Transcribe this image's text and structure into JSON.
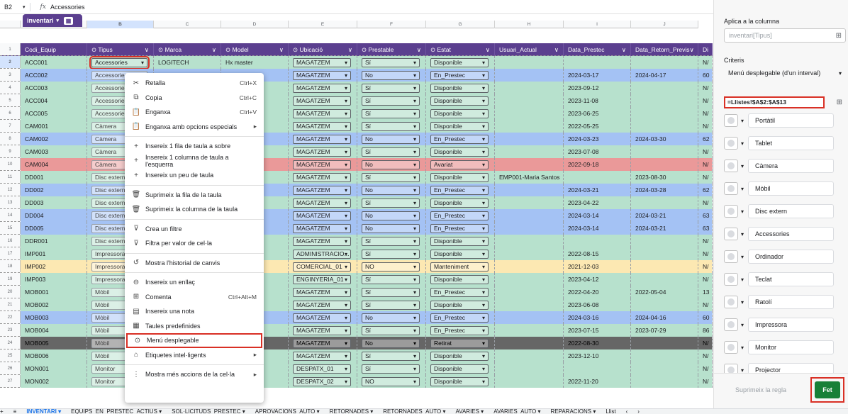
{
  "formula_bar": {
    "cell_ref": "B2",
    "fx": "fx",
    "value": "Accessories"
  },
  "columns": [
    "A",
    "B",
    "C",
    "D",
    "E",
    "F",
    "G",
    "H",
    "I",
    "J"
  ],
  "table_tab": {
    "label": "inventari"
  },
  "headers": [
    "Codi_Equip",
    "Tipus",
    "Marca",
    "Model",
    "Ubicació",
    "Prestable",
    "Estat",
    "Usuari_Actual",
    "Data_Prestec",
    "Data_Retorn_Previs",
    "Di"
  ],
  "rows": [
    {
      "n": "2",
      "bg": "#b7e1cd",
      "a": "ACC001",
      "b": "Accessories",
      "c": "LOGITECH",
      "d": "Hx master",
      "e": "MAGATZEM",
      "f": "Sí",
      "g": "Disponible",
      "h": "",
      "i": "",
      "j": "",
      "k": "N/"
    },
    {
      "n": "3",
      "bg": "#a4c2f4",
      "a": "ACC002",
      "b": "Accessories",
      "c": "",
      "d": "d",
      "e": "MAGATZEM",
      "f": "No",
      "g": "En_Prestec",
      "h": "",
      "i": "2024-03-17",
      "j": "2024-04-17",
      "k": "60"
    },
    {
      "n": "4",
      "bg": "#b7e1cd",
      "a": "ACC003",
      "b": "Accessories",
      "c": "",
      "d": "ve",
      "e": "MAGATZEM",
      "f": "Sí",
      "g": "Disponible",
      "h": "",
      "i": "2023-09-12",
      "j": "",
      "k": "N/"
    },
    {
      "n": "5",
      "bg": "#b7e1cd",
      "a": "ACC004",
      "b": "Accessories",
      "c": "",
      "d": "",
      "e": "MAGATZEM",
      "f": "Sí",
      "g": "Disponible",
      "h": "",
      "i": "2023-11-08",
      "j": "",
      "k": "N/"
    },
    {
      "n": "6",
      "bg": "#b7e1cd",
      "a": "ACC005",
      "b": "Accessories",
      "c": "",
      "d": "t",
      "e": "MAGATZEM",
      "f": "Sí",
      "g": "Disponible",
      "h": "",
      "i": "2023-06-25",
      "j": "",
      "k": "N/"
    },
    {
      "n": "7",
      "bg": "#b7e1cd",
      "a": "CAM001",
      "b": "Càmera",
      "c": "",
      "d": "",
      "e": "MAGATZEM",
      "f": "Sí",
      "g": "Disponible",
      "h": "",
      "i": "2022-05-25",
      "j": "",
      "k": "N/"
    },
    {
      "n": "8",
      "bg": "#a4c2f4",
      "a": "CAM002",
      "b": "Càmera",
      "c": "",
      "d": "",
      "e": "MAGATZEM",
      "f": "No",
      "g": "En_Prestec",
      "h": "",
      "i": "2024-03-23",
      "j": "2024-03-30",
      "k": "62"
    },
    {
      "n": "9",
      "bg": "#b7e1cd",
      "a": "CAM003",
      "b": "Càmera",
      "c": "",
      "d": "",
      "e": "MAGATZEM",
      "f": "Sí",
      "g": "Disponible",
      "h": "",
      "i": "2023-07-08",
      "j": "",
      "k": "N/"
    },
    {
      "n": "10",
      "bg": "#ea9999",
      "a": "CAM004",
      "b": "Càmera",
      "c": "",
      "d": "",
      "e": "MAGATZEM",
      "f": "No",
      "g": "Avariat",
      "h": "",
      "i": "2022-09-18",
      "j": "",
      "k": "N/"
    },
    {
      "n": "11",
      "bg": "#b7e1cd",
      "a": "DD001",
      "b": "Disc extern",
      "c": "",
      "d": "",
      "e": "MAGATZEM",
      "f": "Sí",
      "g": "Disponible",
      "h": "EMP001-Maria Santos",
      "i": "",
      "j": "2023-08-30",
      "k": "N/"
    },
    {
      "n": "12",
      "bg": "#a4c2f4",
      "a": "DD002",
      "b": "Disc extern",
      "c": "",
      "d": "TB",
      "e": "MAGATZEM",
      "f": "No",
      "g": "En_Prestec",
      "h": "",
      "i": "2024-03-21",
      "j": "2024-03-28",
      "k": "62"
    },
    {
      "n": "13",
      "bg": "#b7e1cd",
      "a": "DD003",
      "b": "Disc extern",
      "c": "",
      "d": "",
      "e": "MAGATZEM",
      "f": "Sí",
      "g": "Disponible",
      "h": "",
      "i": "2023-04-22",
      "j": "",
      "k": "N/"
    },
    {
      "n": "14",
      "bg": "#a4c2f4",
      "a": "DD004",
      "b": "Disc extern",
      "c": "",
      "d": "",
      "e": "MAGATZEM",
      "f": "No",
      "g": "En_Prestec",
      "h": "",
      "i": "2024-03-14",
      "j": "2024-03-21",
      "k": "63"
    },
    {
      "n": "15",
      "bg": "#a4c2f4",
      "a": "DD005",
      "b": "Disc extern",
      "c": "",
      "d": "",
      "e": "MAGATZEM",
      "f": "No",
      "g": "En_Prestec",
      "h": "",
      "i": "2024-03-14",
      "j": "2024-03-21",
      "k": "63"
    },
    {
      "n": "16",
      "bg": "#b7e1cd",
      "a": "DDR001",
      "b": "Disc extern",
      "c": "",
      "d": "",
      "e": "MAGATZEM",
      "f": "Sí",
      "g": "Disponible",
      "h": "",
      "i": "",
      "j": "",
      "k": "N/"
    },
    {
      "n": "17",
      "bg": "#b7e1cd",
      "a": "IMP001",
      "b": "Impressora",
      "c": "",
      "d": "1404n",
      "e": "ADMINISTRACIO...",
      "f": "Sí",
      "g": "Disponible",
      "h": "",
      "i": "2022-08-15",
      "j": "",
      "k": "N/"
    },
    {
      "n": "18",
      "bg": "#fce8b2",
      "a": "IMP002",
      "b": "Impressora",
      "c": "",
      "d": "",
      "e": "COMERCIAL_01",
      "f": "NO",
      "g": "Manteniment",
      "h": "",
      "i": "2021-12-03",
      "j": "",
      "k": "N/"
    },
    {
      "n": "19",
      "bg": "#b7e1cd",
      "a": "IMP003",
      "b": "Impressora",
      "c": "",
      "d": "",
      "e": "ENGINYERIA_01",
      "f": "Sí",
      "g": "Disponible",
      "h": "",
      "i": "2023-04-12",
      "j": "",
      "k": "N/"
    },
    {
      "n": "20",
      "bg": "#b7e1cd",
      "a": "MOB001",
      "b": "Mòbil",
      "c": "",
      "d": "",
      "e": "MAGATZEM",
      "f": "Sí",
      "g": "En_Prestec",
      "h": "",
      "i": "2022-04-20",
      "j": "2022-05-04",
      "k": "13"
    },
    {
      "n": "21",
      "bg": "#b7e1cd",
      "a": "MOB002",
      "b": "Mòbil",
      "c": "",
      "d": "",
      "e": "MAGATZEM",
      "f": "Sí",
      "g": "Disponible",
      "h": "",
      "i": "2023-06-08",
      "j": "",
      "k": "N/"
    },
    {
      "n": "22",
      "bg": "#a4c2f4",
      "a": "MOB003",
      "b": "Mòbil",
      "c": "",
      "d": "",
      "e": "MAGATZEM",
      "f": "No",
      "g": "En_Prestec",
      "h": "",
      "i": "2024-03-16",
      "j": "2024-04-16",
      "k": "60"
    },
    {
      "n": "23",
      "bg": "#b7e1cd",
      "a": "MOB004",
      "b": "Mòbil",
      "c": "",
      "d": "",
      "e": "MAGATZEM",
      "f": "Sí",
      "g": "En_Prestec",
      "h": "",
      "i": "2023-07-15",
      "j": "2023-07-29",
      "k": "86"
    },
    {
      "n": "24",
      "bg": "#666666",
      "fg": "#000",
      "a": "MOB005",
      "b": "Mòbil",
      "c": "",
      "d": "",
      "e": "MAGATZEM",
      "f": "No",
      "g": "Retirat",
      "h": "",
      "i": "2022-08-30",
      "j": "",
      "k": "N/"
    },
    {
      "n": "25",
      "bg": "#b7e1cd",
      "a": "MOB006",
      "b": "Mòbil",
      "c": "",
      "d": "",
      "e": "MAGATZEM",
      "f": "Sí",
      "g": "Disponible",
      "h": "",
      "i": "2023-12-10",
      "j": "",
      "k": "N/"
    },
    {
      "n": "26",
      "bg": "#b7e1cd",
      "a": "MON001",
      "b": "Monitor",
      "c": "",
      "d": "",
      "e": "DESPATX_01",
      "f": "Sí",
      "g": "Disponible",
      "h": "",
      "i": "",
      "j": "",
      "k": "N/"
    },
    {
      "n": "27",
      "bg": "#b7e1cd",
      "a": "MON002",
      "b": "Monitor",
      "c": "HP",
      "d": "E24 G5",
      "e": "DESPATX_02",
      "f": "NO",
      "g": "Disponible",
      "h": "",
      "i": "2022-11-20",
      "j": "",
      "k": "N/"
    }
  ],
  "context_menu": [
    {
      "icon": "✂",
      "label": "Retalla",
      "shortcut": "Ctrl+X",
      "name": "cut"
    },
    {
      "icon": "⧉",
      "label": "Copia",
      "shortcut": "Ctrl+C",
      "name": "copy"
    },
    {
      "icon": "📋",
      "label": "Enganxa",
      "shortcut": "Ctrl+V",
      "name": "paste"
    },
    {
      "icon": "📋",
      "label": "Enganxa amb opcions especials",
      "shortcut": "▸",
      "name": "paste-special"
    },
    {
      "div": true
    },
    {
      "icon": "+",
      "label": "Insereix 1 fila de taula a sobre",
      "shortcut": "",
      "name": "insert-row-above"
    },
    {
      "icon": "+",
      "label": "Insereix 1 columna de taula a l'esquerra",
      "shortcut": "",
      "name": "insert-column-left"
    },
    {
      "icon": "+",
      "label": "Insereix un peu de taula",
      "shortcut": "",
      "name": "insert-table-footer"
    },
    {
      "div": true
    },
    {
      "icon": "🗑",
      "label": "Suprimeix la fila de la taula",
      "shortcut": "",
      "name": "delete-table-row"
    },
    {
      "icon": "🗑",
      "label": "Suprimeix la columna de la taula",
      "shortcut": "",
      "name": "delete-table-column"
    },
    {
      "div": true
    },
    {
      "icon": "⊽",
      "label": "Crea un filtre",
      "shortcut": "",
      "name": "create-filter"
    },
    {
      "icon": "⊽",
      "label": "Filtra per valor de cel·la",
      "shortcut": "",
      "name": "filter-by-value"
    },
    {
      "div": true
    },
    {
      "icon": "↺",
      "label": "Mostra l'historial de canvis",
      "shortcut": "",
      "name": "show-edit-history"
    },
    {
      "div": true
    },
    {
      "icon": "⊖",
      "label": "Insereix un enllaç",
      "shortcut": "",
      "name": "insert-link"
    },
    {
      "icon": "⊞",
      "label": "Comenta",
      "shortcut": "Ctrl+Alt+M",
      "name": "comment"
    },
    {
      "icon": "▤",
      "label": "Insereix una nota",
      "shortcut": "",
      "name": "insert-note"
    },
    {
      "icon": "▦",
      "label": "Taules predefinides",
      "shortcut": "",
      "name": "predefined-tables"
    },
    {
      "icon": "⊙",
      "label": "Menú desplegable",
      "shortcut": "",
      "name": "dropdown",
      "hl": true
    },
    {
      "icon": "⌂",
      "label": "Etiquetes intel·ligents",
      "shortcut": "▸",
      "name": "smart-chips"
    },
    {
      "div": true
    },
    {
      "icon": "⋮",
      "label": "Mostra més accions de la cel·la",
      "shortcut": "▸",
      "name": "more-cell-actions"
    }
  ],
  "side": {
    "apply_label": "Aplica a la columna",
    "apply_value": "inventari[Tipus]",
    "criteria_label": "Criteris",
    "criteria_value": "Menú desplegable (d'un interval)",
    "range_value": "=Llistes!$A$2:$A$13",
    "options": [
      "Portàtil",
      "Tablet",
      "Càmera",
      "Mòbil",
      "Disc extern",
      "Accessories",
      "Ordinador",
      "Teclat",
      "Ratolí",
      "Impressora",
      "Monitor",
      "Projector"
    ],
    "delete_label": "Suprimeix la regla",
    "done_label": "Fet",
    "done_color": "#188038"
  },
  "sheet_tabs": [
    "+",
    "≡",
    "INVENTARI ▾",
    "EQUIPS_EN_PRESTEC_ACTIUS ▾",
    "SOL·LICITUDS_PRÉSTEC ▾",
    "APROVACIONS_AUTO ▾",
    "RETORNADES ▾",
    "RETORNADES_AUTO ▾",
    "AVARIES ▾",
    "AVARIES_AUTO ▾",
    "REPARACIONS ▾",
    "Llist",
    "‹",
    "›"
  ]
}
